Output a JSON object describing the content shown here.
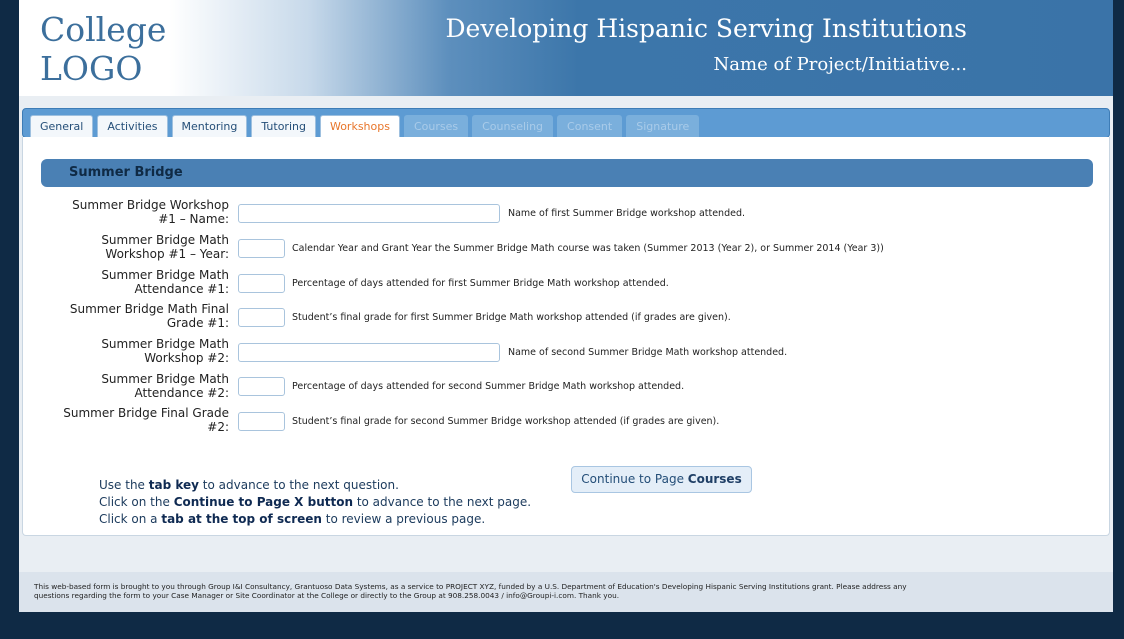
{
  "header": {
    "logo_line1": "College",
    "logo_line2": "LOGO",
    "title": "Developing Hispanic Serving Institutions",
    "subtitle": "Name of Project/Initiative..."
  },
  "tabs": [
    {
      "label": "General",
      "state": "normal"
    },
    {
      "label": "Activities",
      "state": "normal"
    },
    {
      "label": "Mentoring",
      "state": "normal"
    },
    {
      "label": "Tutoring",
      "state": "normal"
    },
    {
      "label": "Workshops",
      "state": "active"
    },
    {
      "label": "Courses",
      "state": "disabled"
    },
    {
      "label": "Counseling",
      "state": "disabled"
    },
    {
      "label": "Consent",
      "state": "disabled"
    },
    {
      "label": "Signature",
      "state": "disabled"
    }
  ],
  "section": {
    "title": "Summer Bridge"
  },
  "fields": [
    {
      "label": "Summer Bridge Workshop #1 – Name:",
      "value": "",
      "hint": "Name of first Summer Bridge workshop attended."
    },
    {
      "label": "Summer Bridge Math Workshop #1 – Year:",
      "value": "",
      "hint": "Calendar Year and Grant Year the Summer Bridge Math course was taken (Summer 2013 (Year 2), or Summer 2014 (Year 3))"
    },
    {
      "label": "Summer Bridge Math Attendance #1:",
      "value": "",
      "hint": "Percentage of days attended for first Summer Bridge Math workshop attended."
    },
    {
      "label": "Summer Bridge Math Final Grade #1:",
      "value": "",
      "hint": "Student’s final grade for first Summer Bridge Math workshop attended (if grades are given)."
    },
    {
      "label": "Summer Bridge Math Workshop #2:",
      "value": "",
      "hint": "Name of second Summer Bridge Math workshop attended."
    },
    {
      "label": "Summer Bridge Math Attendance #2:",
      "value": "",
      "hint": "Percentage of days attended for second Summer Bridge Math workshop attended."
    },
    {
      "label": "Summer Bridge Final Grade #2:",
      "value": "",
      "hint": "Student’s final grade for second Summer Bridge workshop attended (if grades are given)."
    }
  ],
  "instructions": {
    "line1_pre": "Use the ",
    "line1_bold": "tab key",
    "line1_post": " to advance to the next question.",
    "line2_pre": "Click on the ",
    "line2_bold": "Continue to Page X button",
    "line2_post": " to advance to the next page.",
    "line3_pre": "Click on a ",
    "line3_bold": "tab at the top of screen",
    "line3_post": " to review a previous page."
  },
  "continue_button": {
    "prefix": "Continue to Page ",
    "page": "Courses"
  },
  "footer": {
    "line1": "This web-based form is brought to you through Group I&I Consultancy, Grantuoso Data Systems, as a service to PROJECT XYZ, funded by a U.S. Department of Education's Developing Hispanic Serving Institutions grant. Please address any",
    "line2": "questions regarding the form to your Case Manager or Site Coordinator at the College or directly to the Group at 908.258.0043 / info@Groupi-i.com. Thank you."
  }
}
